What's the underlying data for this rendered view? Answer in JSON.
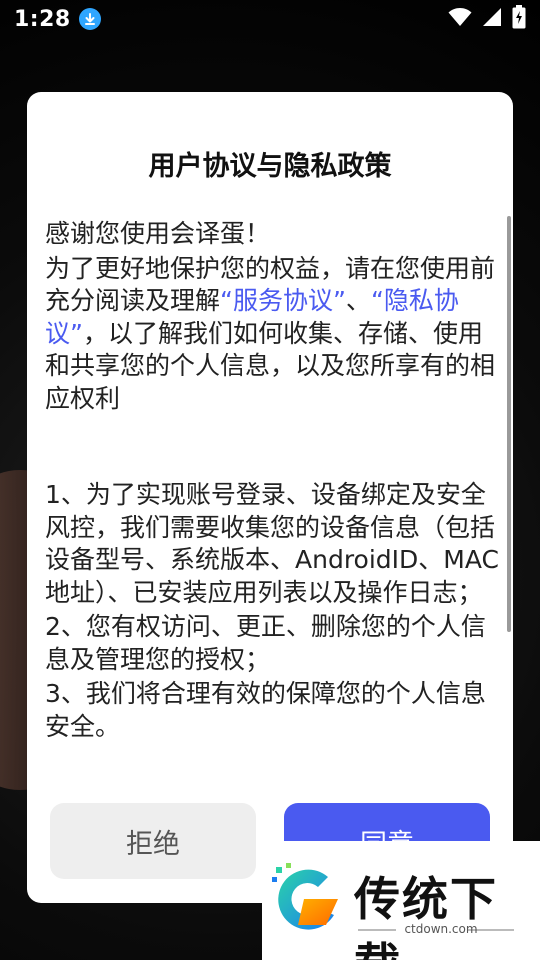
{
  "status_bar": {
    "time": "1:28"
  },
  "dialog": {
    "title": "用户协议与隐私政策",
    "greeting": "感谢您使用会译蛋！",
    "intro_before": "为了更好地保护您的权益，请在您使用前充分阅读及理解",
    "link_service": "“服务协议”",
    "separator": "、",
    "link_privacy": "“隐私协议”",
    "intro_after": "，以了解我们如何收集、存储、使用和共享您的个人信息，以及您所享有的相应权利",
    "items": [
      "1、为了实现账号登录、设备绑定及安全风控，我们需要收集您的设备信息（包括设备型号、系统版本、AndroidID、MAC 地址）、已安装应用列表以及操作日志；",
      "2、您有权访问、更正、删除您的个人信息及管理您的授权；",
      "3、我们将合理有效的保障您的个人信息安全。"
    ],
    "refuse_label": "拒绝",
    "agree_label": "同意"
  },
  "watermark": {
    "title": "传统下载",
    "url": "ctdown.com"
  },
  "colors": {
    "accent": "#4a5af0",
    "refuse_bg": "#eeeeee",
    "download_badge": "#2fa6ff"
  },
  "icons": [
    "download-icon",
    "wifi-icon",
    "signal-icon",
    "battery-icon",
    "ctdown-logo"
  ]
}
